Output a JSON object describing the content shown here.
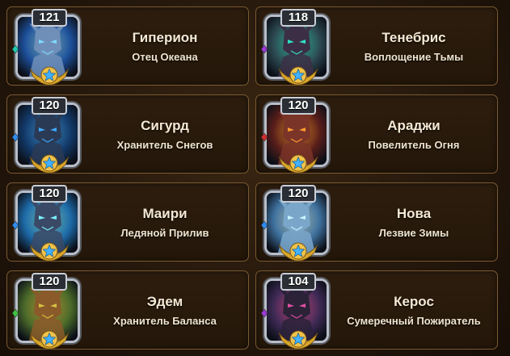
{
  "heroes": [
    {
      "level": "121",
      "name": "Гиперион",
      "title": "Отец Океана",
      "bg": "#1d4f9a",
      "face": "#6f8fb8",
      "accent": "#7fd8ff",
      "gem": "#1fc9b0"
    },
    {
      "level": "118",
      "name": "Тенебрис",
      "title": "Воплощение Тьмы",
      "bg": "#2d4a52",
      "face": "#3c2f45",
      "accent": "#2ee3c6",
      "gem": "#9a3bd1"
    },
    {
      "level": "120",
      "name": "Сигурд",
      "title": "Хранитель Снегов",
      "bg": "#123a6a",
      "face": "#2a3a55",
      "accent": "#3ea8ff",
      "gem": "#2f8df0"
    },
    {
      "level": "120",
      "name": "Араджи",
      "title": "Повелитель Огня",
      "bg": "#5a1e1a",
      "face": "#7a3428",
      "accent": "#ff9b2e",
      "gem": "#cf2f2f"
    },
    {
      "level": "120",
      "name": "Маири",
      "title": "Ледяной Прилив",
      "bg": "#1d6aa8",
      "face": "#3a4a66",
      "accent": "#7af0ff",
      "gem": "#2f8df0"
    },
    {
      "level": "120",
      "name": "Нова",
      "title": "Лезвие Зимы",
      "bg": "#3d6f9c",
      "face": "#7aa6c9",
      "accent": "#c7f4ff",
      "gem": "#2f8df0"
    },
    {
      "level": "120",
      "name": "Эдем",
      "title": "Хранитель Баланса",
      "bg": "#4a6a2a",
      "face": "#8a5a2a",
      "accent": "#d6c040",
      "gem": "#3ec33e"
    },
    {
      "level": "104",
      "name": "Керос",
      "title": "Сумеречный Пожиратель",
      "bg": "#3e2a55",
      "face": "#2b2238",
      "accent": "#e04fa0",
      "gem": "#9a3bd1"
    }
  ]
}
